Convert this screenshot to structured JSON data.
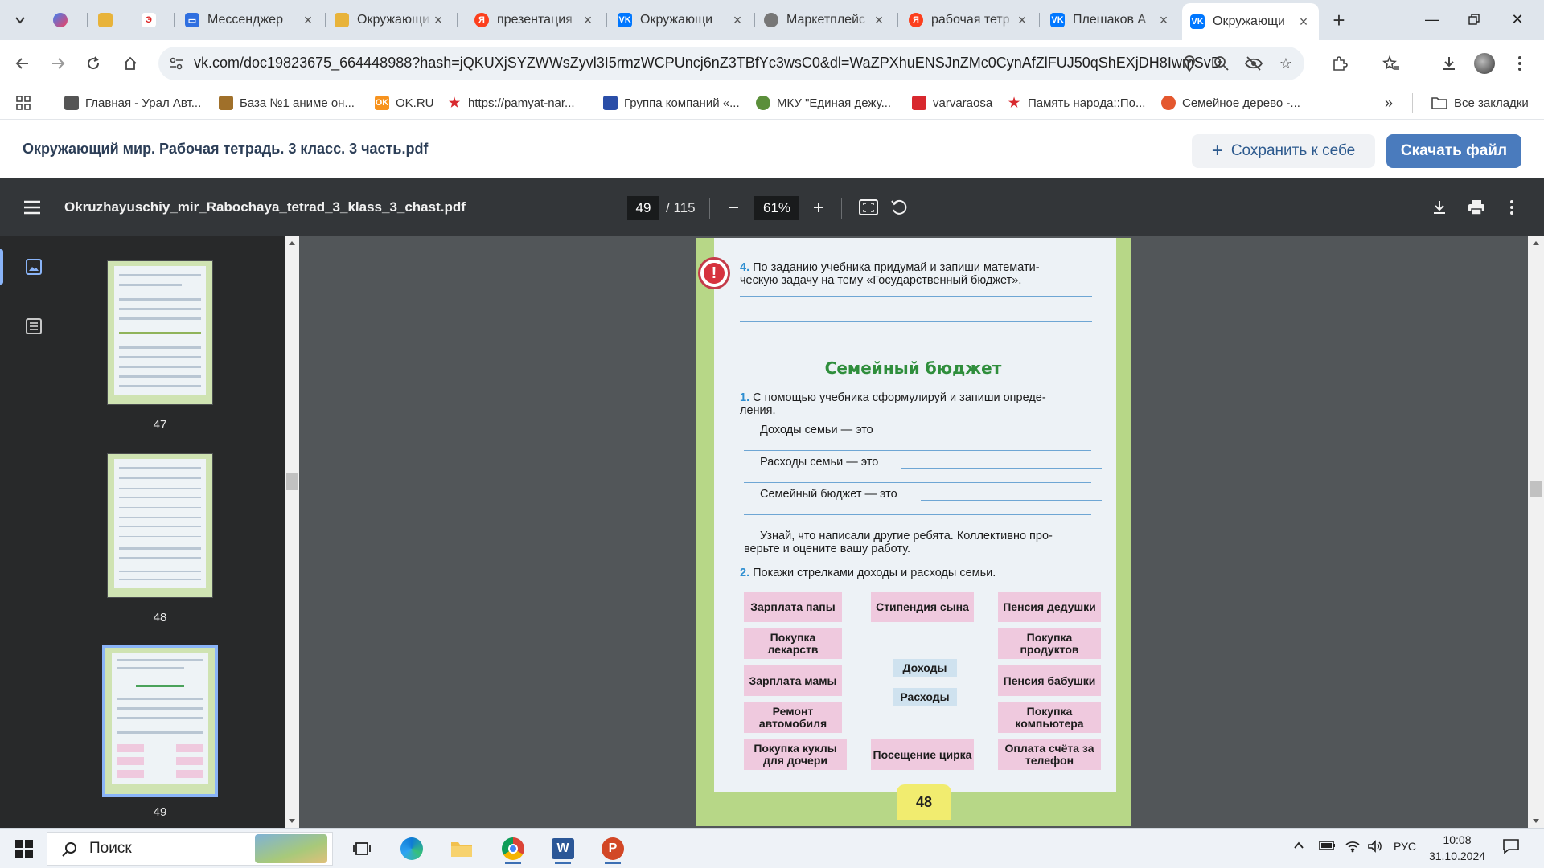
{
  "browser": {
    "tabs": [
      {
        "title": "",
        "icon": "vk-colorful-icon",
        "color": "#3b82f6"
      },
      {
        "title": "",
        "icon": "grid-app-icon",
        "color": "#e8b33a"
      },
      {
        "title": "",
        "icon": "em-icon",
        "color": "#d22"
      },
      {
        "title": "Мессенджер",
        "icon": "messenger-icon",
        "color": "#2f6fe0"
      },
      {
        "title": "Окружающи",
        "icon": "doc-icon",
        "color": "#e8b33a"
      },
      {
        "title": "презентация",
        "icon": "yandex-icon",
        "color": "#fc3f1d"
      },
      {
        "title": "Окружающи",
        "icon": "vk-icon",
        "color": "#0077ff"
      },
      {
        "title": "Маркетплейс",
        "icon": "globe-icon",
        "color": "#777777"
      },
      {
        "title": "рабочая тетр",
        "icon": "yandex-icon",
        "color": "#fc3f1d"
      },
      {
        "title": "Плешаков А",
        "icon": "vk-icon",
        "color": "#0077ff"
      },
      {
        "title": "Окружающи",
        "icon": "vk-icon",
        "color": "#0077ff",
        "active": true
      }
    ],
    "url": "vk.com/doc19823675_664448988?hash=jQKUXjSYZWWsZyvl3I5rmzWCPUncj6nZ3TBfYc3wsC0&dl=WaZPXhuENSJnZMc0CynAfZlFUJ50qShEXjDH8IwmSvD",
    "bookmarks": [
      {
        "label": "Главная - Урал Авт...",
        "icon": "car-icon",
        "color": "#555555"
      },
      {
        "label": "База №1 аниме он...",
        "icon": "anime-icon",
        "color": "#a0702a"
      },
      {
        "label": "OK.RU",
        "icon": "ok-icon",
        "color": "#f7931e"
      },
      {
        "label": "https://pamyat-nar...",
        "icon": "star-icon",
        "color": "#d8282e"
      },
      {
        "label": "Группа компаний «...",
        "icon": "shield-icon",
        "color": "#2a4ea8"
      },
      {
        "label": "МКУ \"Единая дежу...",
        "icon": "globe-icon",
        "color": "#5b8f3a"
      },
      {
        "label": "varvaraosa",
        "icon": "flag-icon",
        "color": "#d8282e"
      },
      {
        "label": "Память народа::По...",
        "icon": "star-icon",
        "color": "#d8282e"
      },
      {
        "label": "Семейное дерево -...",
        "icon": "tree-icon",
        "color": "#e4572e"
      }
    ],
    "all_bookmarks_label": "Все закладки"
  },
  "vk": {
    "doc_title": "Окружающий мир. Рабочая тетрадь. 3 класс. 3 часть.pdf",
    "save_label": "Сохранить к себе",
    "download_label": "Скачать файл"
  },
  "pdf": {
    "filename": "Okruzhayuschiy_mir_Rabochaya_tetrad_3_klass_3_chast.pdf",
    "page_current": "49",
    "page_total": "/ 115",
    "zoom": "61%",
    "thumbnails": [
      {
        "label": "47",
        "color": "#c6dca0"
      },
      {
        "label": "48",
        "color": "#c6dca0"
      },
      {
        "label": "49",
        "color": "#c6dca0",
        "selected": true
      }
    ]
  },
  "page": {
    "task4_num": "4.",
    "task4_line1": "По заданию учебника придумай и запиши математи-",
    "task4_line2": "ческую задачу на тему «Государственный бюджет».",
    "section_title": "Семейный бюджет",
    "task1_num": "1.",
    "task1_line1": "С помощью учебника сформулируй и запиши опреде-",
    "task1_line2": "ления.",
    "def_income": "Доходы семьи — это",
    "def_expense": "Расходы семьи — это",
    "def_budget": "Семейный бюджет — это",
    "learn_line1": "Узнай, что написали другие ребята. Коллективно про-",
    "learn_line2": "верьте и оцените вашу  работу.",
    "task2_num": "2.",
    "task2_text": "Покажи стрелками доходы и расходы семьи.",
    "boxes": {
      "papa_salary": "Зарплата папы",
      "stipend": "Стипендия сына",
      "grandpa_pension": "Пенсия дедушки",
      "medicine": "Покупка лекарств",
      "food": "Покупка продуктов",
      "income": "Доходы",
      "mama_salary": "Зарплата мамы",
      "grandma_pension": "Пенсия бабушки",
      "expense": "Расходы",
      "car_repair": "Ремонт автомобиля",
      "computer": "Покупка компьютера",
      "doll": "Покупка куклы для дочери",
      "circus": "Посещение цирка",
      "phone": "Оплата счёта за телефон"
    },
    "page_number": "48",
    "colors": {
      "page_bg": "#b7d787",
      "box_pink": "#efc9de",
      "box_blue": "#cfe2ef",
      "title_green": "#2f8e3c",
      "warn_red": "#d6323e"
    }
  },
  "taskbar": {
    "search_label": "Поиск",
    "lang": "РУС",
    "time": "10:08",
    "date": "31.10.2024",
    "apps": [
      "task-view-icon",
      "edge-icon",
      "explorer-icon",
      "chrome-icon",
      "word-icon",
      "powerpoint-icon"
    ]
  }
}
